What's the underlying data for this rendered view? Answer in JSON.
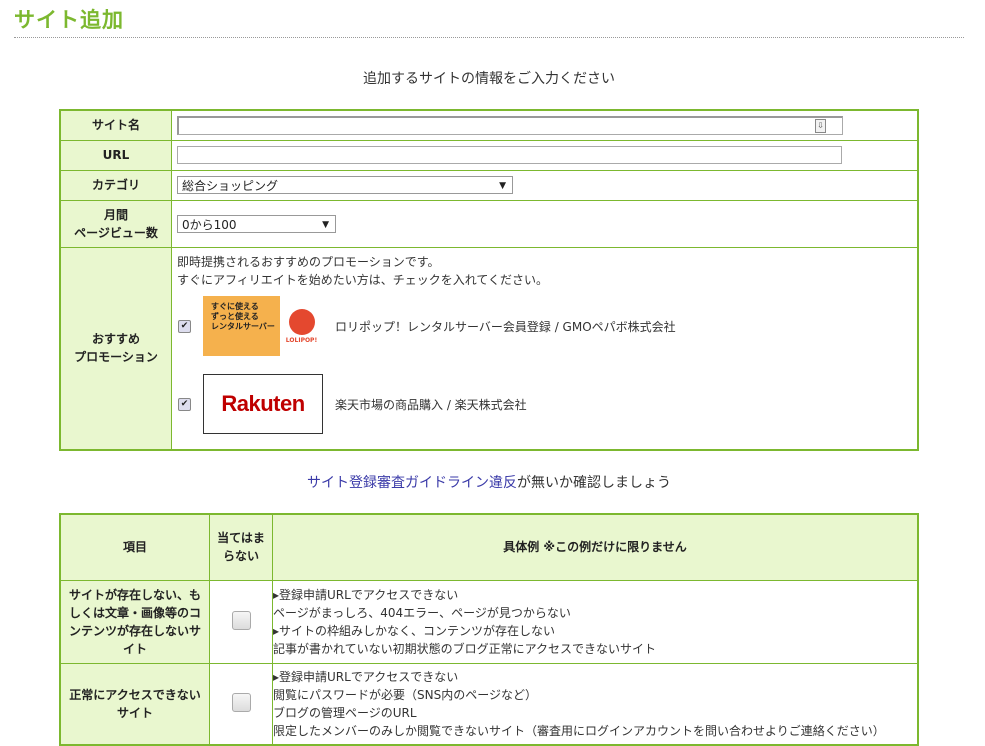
{
  "page_title": "サイト追加",
  "intro": "追加するサイトの情報をご入力ください",
  "form": {
    "site_name_label": "サイト名",
    "site_name_value": "",
    "url_label": "URL",
    "url_value": "",
    "category_label": "カテゴリ",
    "category_value": "総合ショッピング",
    "pv_label_line1": "月間",
    "pv_label_line2": "ページビュー数",
    "pv_value": "0から100",
    "promo_label_line1": "おすすめ",
    "promo_label_line2": "プロモーション",
    "promo_intro_line1": "即時提携されるおすすめのプロモーションです。",
    "promo_intro_line2": "すぐにアフィリエイトを始めたい方は、チェックを入れてください。",
    "promotions": [
      {
        "label": "ロリポップ！レンタルサーバー会員登録 / GMOペパボ株式会社",
        "checked": true,
        "banner_text": [
          "すぐに使える",
          "ずっと使える",
          "レンタルサーバー"
        ],
        "banner_brand": "LOLIPOP!"
      },
      {
        "label": "楽天市場の商品購入 / 楽天株式会社",
        "checked": true,
        "banner_brand": "Rakuten"
      }
    ]
  },
  "guide": {
    "link_text": "サイト登録審査ガイドライン違反",
    "rest_text": "が無いか確認しましょう"
  },
  "check_table": {
    "col_item": "項目",
    "col_na": "当てはまらない",
    "col_example": "具体例 ※この例だけに限りません",
    "rows": [
      {
        "item": "サイトが存在しない、もしくは文章・画像等のコンテンツが存在しないサイト",
        "examples": [
          "▸登録申請URLでアクセスできない",
          "ページがまっしろ、404エラー、ページが見つからない",
          "▸サイトの枠組みしかなく、コンテンツが存在しない",
          "記事が書かれていない初期状態のブログ正常にアクセスできないサイト"
        ]
      },
      {
        "item": "正常にアクセスできないサイト",
        "examples": [
          "▸登録申請URLでアクセスできない",
          "閲覧にパスワードが必要（SNS内のページなど）",
          "ブログの管理ページのURL",
          "限定したメンバーのみしか閲覧できないサイト（審査用にログインアカウントを問い合わせよりご連絡ください）"
        ]
      }
    ]
  },
  "colors": {
    "accent_green": "#7cb82f",
    "header_bg": "#e9f7cf",
    "link_blue": "#3a3aa8",
    "rakuten_red": "#bf0000"
  }
}
